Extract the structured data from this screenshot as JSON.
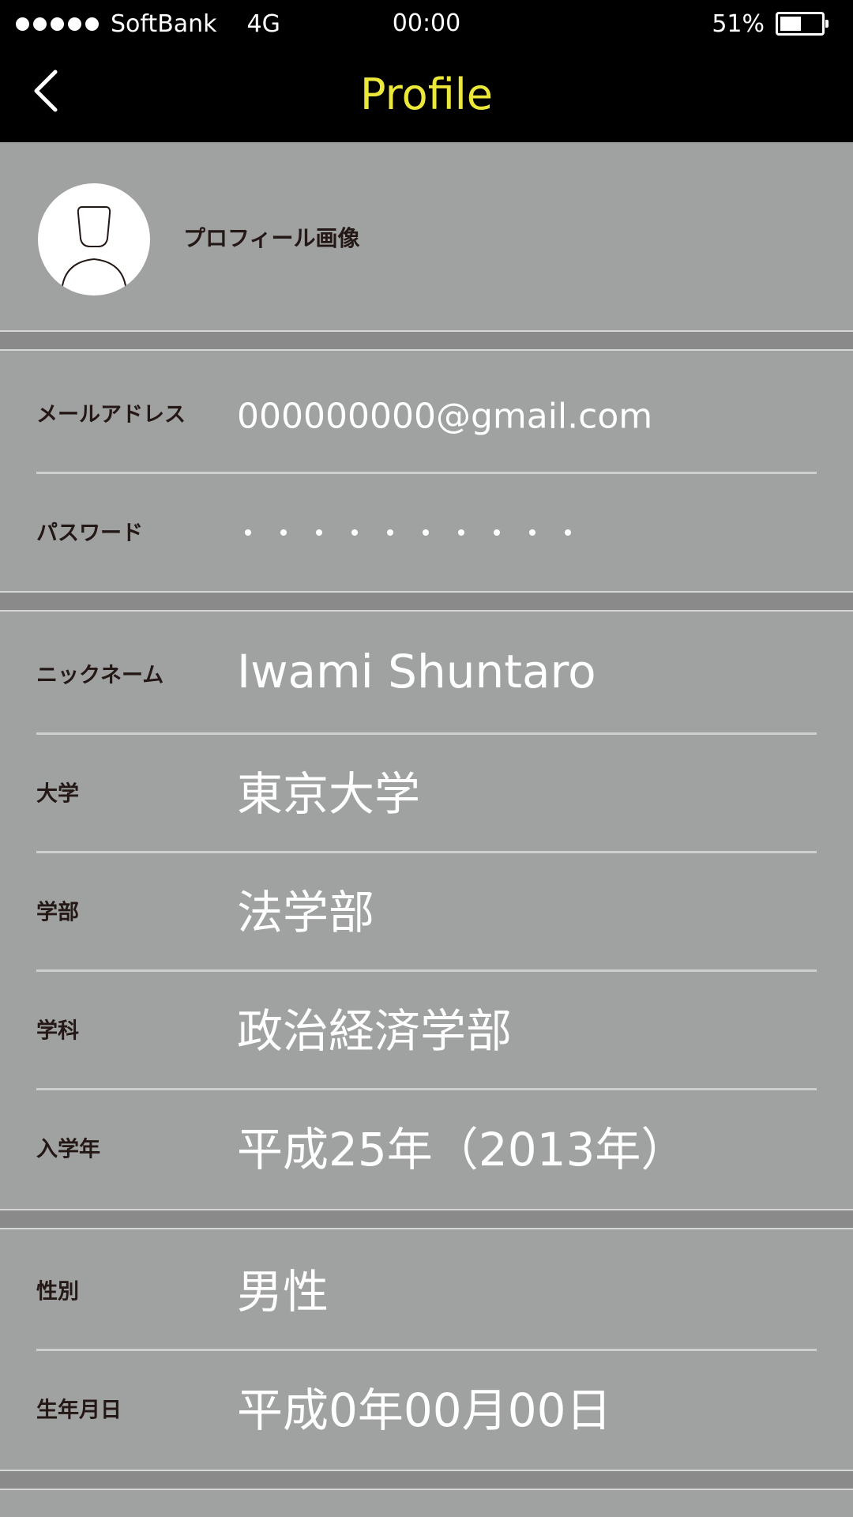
{
  "status_bar": {
    "carrier": "SoftBank",
    "network": "4G",
    "time": "00:00",
    "battery_text": "51%",
    "battery_level": 0.51
  },
  "nav": {
    "title": "Profile",
    "back_icon": "chevron-left-icon",
    "title_color": "#ece83a"
  },
  "profile_photo": {
    "label": "プロフィール画像",
    "icon": "avatar-placeholder-icon"
  },
  "account": {
    "email_label": "メールアドレス",
    "email_value": "000000000@gmail.com",
    "password_label": "パスワード",
    "password_masked_count": 10
  },
  "school": {
    "nickname_label": "ニックネーム",
    "nickname_value": "Iwami Shuntaro",
    "university_label": "大学",
    "university_value": "東京大学",
    "faculty_label": "学部",
    "faculty_value": "法学部",
    "department_label": "学科",
    "department_value": "政治経済学部",
    "enrollment_label": "入学年",
    "enrollment_value": "平成25年（2013年）"
  },
  "personal": {
    "gender_label": "性別",
    "gender_value": "男性",
    "birthday_label": "生年月日",
    "birthday_value": "平成0年00月00日"
  },
  "colors": {
    "background": "#a0a1a1",
    "separator": "#8a8a8a",
    "header": "#000000",
    "label_text": "#231815",
    "value_text": "#ffffff"
  }
}
